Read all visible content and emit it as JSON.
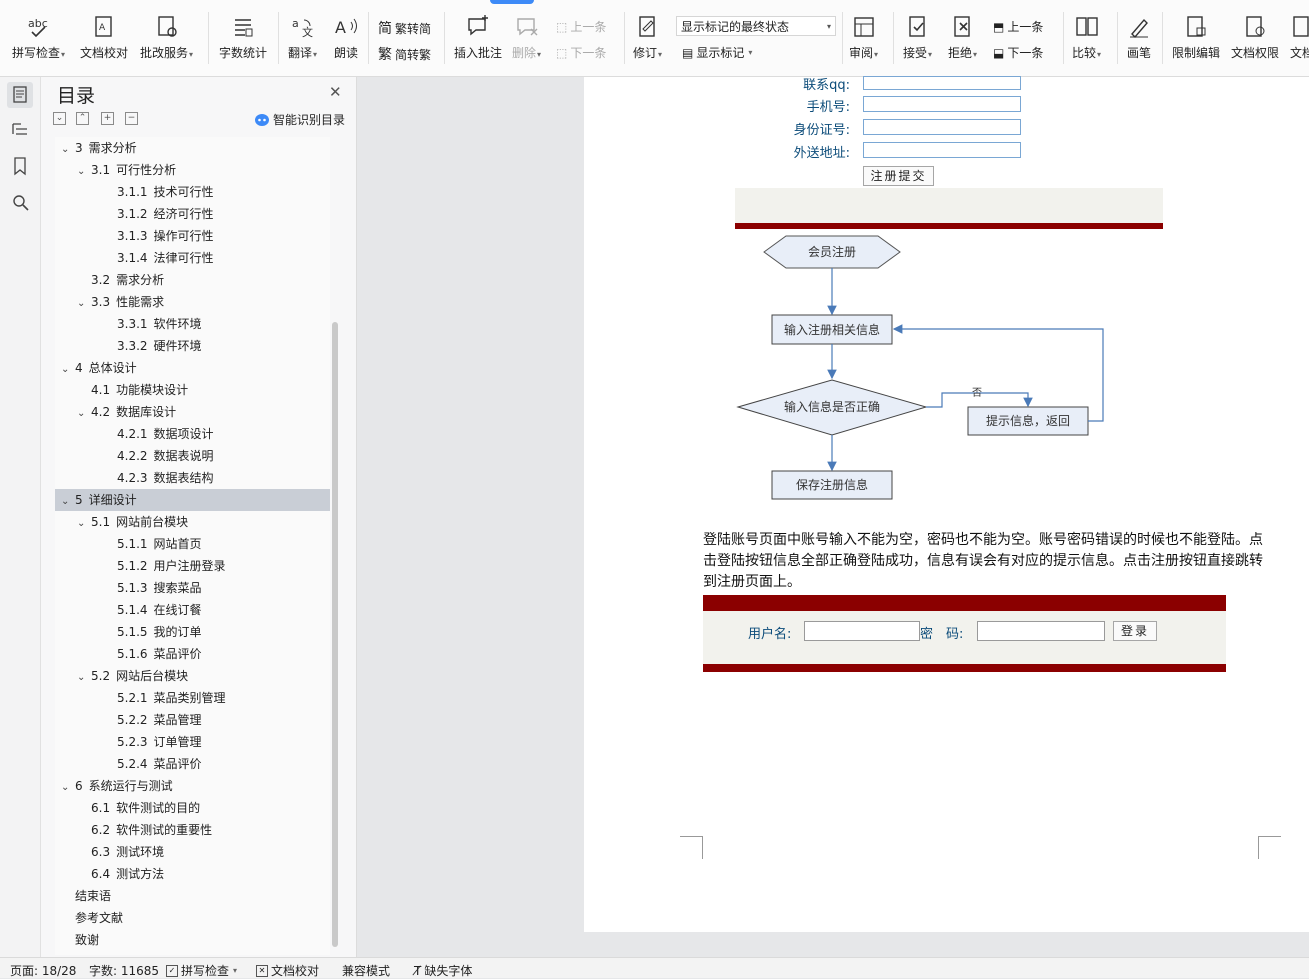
{
  "ribbon": {
    "spellcheck": "拼写检查",
    "proofread": "文档校对",
    "batch_service": "批改服务",
    "word_count": "字数统计",
    "translate": "翻译",
    "read_aloud": "朗读",
    "trad_to_simp": "繁转简",
    "simp_to_trad": "简转繁",
    "insert_comment": "插入批注",
    "delete": "删除",
    "prev_comment": "上一条",
    "next_comment": "下一条",
    "revise": "修订",
    "markup_state": "显示标记的最终状态",
    "show_markup": "显示标记",
    "review": "审阅",
    "accept": "接受",
    "reject": "拒绝",
    "prev_change": "上一条",
    "next_change": "下一条",
    "compare": "比较",
    "pen": "画笔",
    "restrict_edit": "限制编辑",
    "doc_permission": "文档权限",
    "doc_more": "文档"
  },
  "toc": {
    "title": "目录",
    "smart_label": "智能识别目录",
    "items": [
      {
        "level": 1,
        "chev": true,
        "num": "3",
        "text": "需求分析"
      },
      {
        "level": 2,
        "chev": true,
        "num": "3.1",
        "text": "可行性分析"
      },
      {
        "level": 3,
        "chev": false,
        "num": "3.1.1",
        "text": "技术可行性"
      },
      {
        "level": 3,
        "chev": false,
        "num": "3.1.2",
        "text": "经济可行性"
      },
      {
        "level": 3,
        "chev": false,
        "num": "3.1.3",
        "text": "操作可行性"
      },
      {
        "level": 3,
        "chev": false,
        "num": "3.1.4",
        "text": "法律可行性"
      },
      {
        "level": 2,
        "chev": false,
        "num": "3.2",
        "text": "需求分析"
      },
      {
        "level": 2,
        "chev": true,
        "num": "3.3",
        "text": "性能需求"
      },
      {
        "level": 3,
        "chev": false,
        "num": "3.3.1",
        "text": "软件环境"
      },
      {
        "level": 3,
        "chev": false,
        "num": "3.3.2",
        "text": "硬件环境"
      },
      {
        "level": 1,
        "chev": true,
        "num": "4",
        "text": "总体设计"
      },
      {
        "level": 2,
        "chev": false,
        "num": "4.1",
        "text": "功能模块设计"
      },
      {
        "level": 2,
        "chev": true,
        "num": "4.2",
        "text": "数据库设计"
      },
      {
        "level": 3,
        "chev": false,
        "num": "4.2.1",
        "text": "数据项设计"
      },
      {
        "level": 3,
        "chev": false,
        "num": "4.2.2",
        "text": "数据表说明"
      },
      {
        "level": 3,
        "chev": false,
        "num": "4.2.3",
        "text": "数据表结构"
      },
      {
        "level": 1,
        "chev": true,
        "num": "5",
        "text": "详细设计",
        "selected": true
      },
      {
        "level": 2,
        "chev": true,
        "num": "5.1",
        "text": "网站前台模块"
      },
      {
        "level": 3,
        "chev": false,
        "num": "5.1.1",
        "text": "网站首页"
      },
      {
        "level": 3,
        "chev": false,
        "num": "5.1.2",
        "text": "用户注册登录"
      },
      {
        "level": 3,
        "chev": false,
        "num": "5.1.3",
        "text": "搜索菜品"
      },
      {
        "level": 3,
        "chev": false,
        "num": "5.1.4",
        "text": "在线订餐"
      },
      {
        "level": 3,
        "chev": false,
        "num": "5.1.5",
        "text": "我的订单"
      },
      {
        "level": 3,
        "chev": false,
        "num": "5.1.6",
        "text": "菜品评价"
      },
      {
        "level": 2,
        "chev": true,
        "num": "5.2",
        "text": "网站后台模块"
      },
      {
        "level": 3,
        "chev": false,
        "num": "5.2.1",
        "text": "菜品类别管理"
      },
      {
        "level": 3,
        "chev": false,
        "num": "5.2.2",
        "text": "菜品管理"
      },
      {
        "level": 3,
        "chev": false,
        "num": "5.2.3",
        "text": "订单管理"
      },
      {
        "level": 3,
        "chev": false,
        "num": "5.2.4",
        "text": "菜品评价"
      },
      {
        "level": 1,
        "chev": true,
        "num": "6",
        "text": "系统运行与测试"
      },
      {
        "level": 2,
        "chev": false,
        "num": "6.1",
        "text": "软件测试的目的"
      },
      {
        "level": 2,
        "chev": false,
        "num": "6.2",
        "text": "软件测试的重要性"
      },
      {
        "level": 2,
        "chev": false,
        "num": "6.3",
        "text": "测试环境"
      },
      {
        "level": 2,
        "chev": false,
        "num": "6.4",
        "text": "测试方法"
      },
      {
        "level": 1,
        "chev": false,
        "num": "",
        "text": "结束语"
      },
      {
        "level": 1,
        "chev": false,
        "num": "",
        "text": "参考文献"
      },
      {
        "level": 1,
        "chev": false,
        "num": "",
        "text": "致谢"
      }
    ]
  },
  "doc": {
    "form_labels": [
      "联系qq:",
      "手机号:",
      "身份证号:",
      "外送地址:"
    ],
    "submit": "注册提交",
    "flow": {
      "start": "会员注册",
      "input": "输入注册相关信息",
      "decision": "输入信息是否正确",
      "no": "否",
      "prompt": "提示信息，返回",
      "save": "保存注册信息"
    },
    "paragraph": "登陆账号页面中账号输入不能为空，密码也不能为空。账号密码错误的时候也不能登陆。点击登陆按钮信息全部正确登陆成功，信息有误会有对应的提示信息。点击注册按钮直接跳转到注册页面上。",
    "login": {
      "username": "用户名:",
      "password": "密　码:",
      "button": "登录"
    }
  },
  "status": {
    "page": "页面: 18/28",
    "words": "字数: 11685",
    "spellcheck": "拼写检查",
    "proofread": "文档校对",
    "compat": "兼容模式",
    "missing_font": "缺失字体"
  }
}
